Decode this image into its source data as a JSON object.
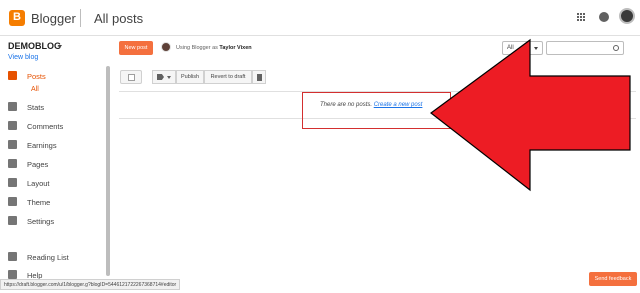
{
  "header": {
    "brand": "Blogger",
    "section_title": "All posts"
  },
  "sidebar": {
    "blog_name": "DEMOBLOG",
    "view_blog": "View blog",
    "sub_all": "All",
    "items": [
      {
        "label": "Posts",
        "icon": "posts-icon"
      },
      {
        "label": "Stats",
        "icon": "stats-icon"
      },
      {
        "label": "Comments",
        "icon": "comments-icon"
      },
      {
        "label": "Earnings",
        "icon": "dollar-icon"
      },
      {
        "label": "Pages",
        "icon": "pages-icon"
      },
      {
        "label": "Layout",
        "icon": "layout-icon"
      },
      {
        "label": "Theme",
        "icon": "theme-icon"
      },
      {
        "label": "Settings",
        "icon": "gear-icon"
      },
      {
        "label": "Reading List",
        "icon": "bookmark-icon"
      },
      {
        "label": "Help",
        "icon": "help-icon"
      }
    ]
  },
  "main": {
    "new_post": "New post",
    "using_prefix": "Using Blogger as",
    "user_name": "Taylor Vixen",
    "filter_value": "All",
    "toolbar": {
      "publish": "Publish",
      "revert": "Revert to draft"
    },
    "empty_text": "There are no posts.",
    "create_link": "Create a new post"
  },
  "status_url": "https://draft.blogger.com/u/1/blogger.g?blogID=5446121722267368714#editor",
  "send_feedback": "Send feedback",
  "colors": {
    "accent": "#f4703e",
    "arrow": "#ed1c24",
    "highlight": "#d32f2f"
  }
}
